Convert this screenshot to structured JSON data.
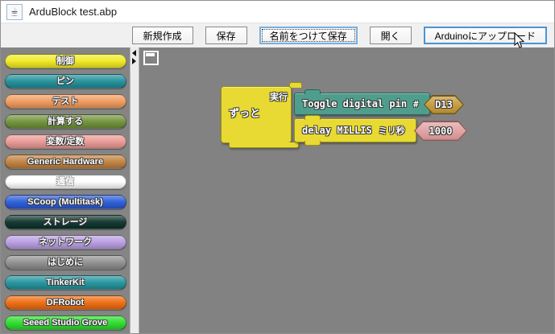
{
  "window": {
    "title": "ArduBlock test.abp",
    "title_icon": "java-coffee-cup-icon"
  },
  "toolbar": {
    "buttons": [
      {
        "id": "new",
        "label": "新規作成",
        "state": "normal"
      },
      {
        "id": "save",
        "label": "保存",
        "state": "normal"
      },
      {
        "id": "save-as",
        "label": "名前をつけて保存",
        "state": "focused"
      },
      {
        "id": "open",
        "label": "開く",
        "state": "normal"
      },
      {
        "id": "upload",
        "label": "Arduinoにアップロード",
        "state": "hovered"
      }
    ]
  },
  "sidebar": {
    "categories": [
      {
        "label": "制御",
        "color": "#f0ea1f"
      },
      {
        "label": "ピン",
        "color": "#1d8e9a"
      },
      {
        "label": "テスト",
        "color": "#f0995a"
      },
      {
        "label": "計算する",
        "color": "#6e9137"
      },
      {
        "label": "変数/定数",
        "color": "#e99793"
      },
      {
        "label": "Generic Hardware",
        "color": "#c07f3c"
      },
      {
        "label": "通信",
        "color": "#ffffff",
        "text_outline": "#a5a5a5"
      },
      {
        "label": "SCoop (Multitask)",
        "color": "#2759d8"
      },
      {
        "label": "ストレージ",
        "color": "#0a3029"
      },
      {
        "label": "ネットワーク",
        "color": "#b79be1"
      },
      {
        "label": "はじめに",
        "color": "#8e8e8e"
      },
      {
        "label": "TinkerKit",
        "color": "#1f929b"
      },
      {
        "label": "DFRobot",
        "color": "#ee6a0c"
      },
      {
        "label": "Seeed Studio Grove",
        "color": "#28dd28"
      }
    ]
  },
  "canvas": {
    "background_color": "#828282",
    "program": {
      "loop_block": {
        "label": "ずっと",
        "slot_label": "実行",
        "color": "#e8da33"
      },
      "statements": [
        {
          "label": "Toggle digital pin",
          "param_label": "#",
          "value": "D13",
          "block_color": "#4f9e8d",
          "value_color": "#c49a3d"
        },
        {
          "label": "delay MILLIS",
          "param_label": "ミリ秒",
          "value": "1000",
          "block_color": "#e8da33",
          "value_color": "#e0a1a1"
        }
      ]
    }
  }
}
